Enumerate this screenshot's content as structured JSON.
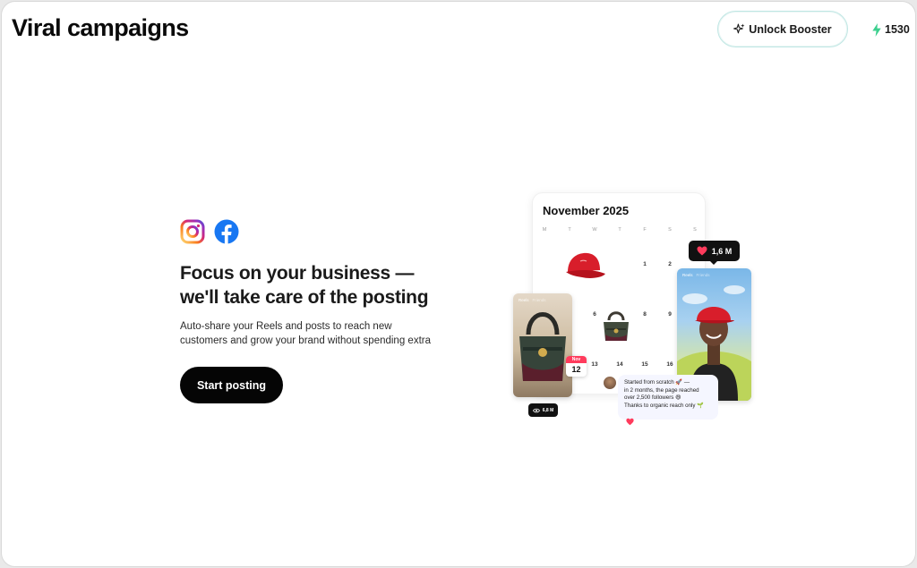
{
  "header": {
    "title": "Viral campaigns",
    "booster_label": "Unlock Booster",
    "credits": "1530"
  },
  "hero": {
    "headline_line1": "Focus on your business —",
    "headline_line2": "we'll take care of the posting",
    "sub_line1": "Auto-share your Reels and posts to reach new",
    "sub_line2": "customers and grow your brand without spending extra",
    "cta_label": "Start posting",
    "platforms": [
      "instagram-icon",
      "facebook-icon"
    ]
  },
  "illustration": {
    "calendar_title": "November 2025",
    "weekdays": [
      "M",
      "T",
      "W",
      "T",
      "F",
      "S",
      "S"
    ],
    "days": [
      "1",
      "2",
      "6",
      "8",
      "9",
      "13",
      "14",
      "15",
      "16"
    ],
    "likes": "1,6 M",
    "views": "6,8 M",
    "badge_month": "Nov",
    "badge_day": "12",
    "tab_reels": "Reels",
    "tab_friends": "Friends",
    "comment_line1": "Started from scratch 🚀 —",
    "comment_line2": "in 2 months, the page reached",
    "comment_line3": "over 2,500 followers 😄",
    "comment_line4": "Thanks to organic reach only 🌱"
  },
  "colors": {
    "cta_bg": "#050505",
    "booster_border": "#bfe6e3",
    "credits_bolt": "#3ccf8e",
    "instagram_gradient": [
      "#feda75",
      "#d62976",
      "#962fbf",
      "#4f5bd5"
    ],
    "facebook": "#1877f2",
    "heart": "#ff3b5c"
  }
}
